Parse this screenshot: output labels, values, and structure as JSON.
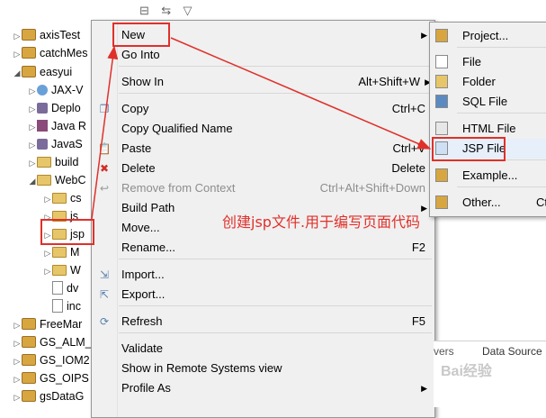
{
  "explorer": {
    "items": [
      {
        "label": "axisTest",
        "indent": 0,
        "twisty": "▷",
        "icon": "project-icon"
      },
      {
        "label": "catchMes",
        "indent": 0,
        "twisty": "▷",
        "icon": "project-icon"
      },
      {
        "label": "easyui",
        "indent": 0,
        "twisty": "◢",
        "icon": "project-icon"
      },
      {
        "label": "JAX-V",
        "indent": 1,
        "twisty": "▷",
        "icon": "web-service-icon"
      },
      {
        "label": "Deplo",
        "indent": 1,
        "twisty": "▷",
        "icon": "deploy-icon"
      },
      {
        "label": "Java R",
        "indent": 1,
        "twisty": "▷",
        "icon": "java-resources-icon"
      },
      {
        "label": "JavaS",
        "indent": 1,
        "twisty": "▷",
        "icon": "library-icon"
      },
      {
        "label": "build",
        "indent": 1,
        "twisty": "▷",
        "icon": "folder-icon"
      },
      {
        "label": "WebC",
        "indent": 1,
        "twisty": "◢",
        "icon": "folder-icon"
      },
      {
        "label": "cs",
        "indent": 2,
        "twisty": "▷",
        "icon": "folder-icon"
      },
      {
        "label": "js",
        "indent": 2,
        "twisty": "▷",
        "icon": "folder-icon"
      },
      {
        "label": "jsp",
        "indent": 2,
        "twisty": "▷",
        "icon": "folder-icon"
      },
      {
        "label": "M",
        "indent": 2,
        "twisty": "▷",
        "icon": "folder-icon"
      },
      {
        "label": "W",
        "indent": 2,
        "twisty": "▷",
        "icon": "folder-icon"
      },
      {
        "label": "dv",
        "indent": 2,
        "twisty": "",
        "icon": "file-icon"
      },
      {
        "label": "inc",
        "indent": 2,
        "twisty": "",
        "icon": "file-icon"
      },
      {
        "label": "FreeMar",
        "indent": 0,
        "twisty": "▷",
        "icon": "project-icon"
      },
      {
        "label": "GS_ALM_",
        "indent": 0,
        "twisty": "▷",
        "icon": "project-icon"
      },
      {
        "label": "GS_IOM2",
        "indent": 0,
        "twisty": "▷",
        "icon": "project-icon"
      },
      {
        "label": "GS_OIPS",
        "indent": 0,
        "twisty": "▷",
        "icon": "project-icon"
      },
      {
        "label": "gsDataG",
        "indent": 0,
        "twisty": "▷",
        "icon": "project-icon"
      }
    ]
  },
  "context_menu": {
    "items": [
      {
        "label": "New",
        "shortcut": "",
        "submenu": true,
        "disabled": false,
        "icon": ""
      },
      {
        "label": "Go Into",
        "shortcut": "",
        "submenu": false,
        "disabled": false,
        "icon": ""
      },
      {
        "label": "Show In",
        "shortcut": "Alt+Shift+W",
        "submenu": true,
        "disabled": false,
        "icon": ""
      },
      {
        "label": "Copy",
        "shortcut": "Ctrl+C",
        "submenu": false,
        "disabled": false,
        "icon": "copy-icon"
      },
      {
        "label": "Copy Qualified Name",
        "shortcut": "",
        "submenu": false,
        "disabled": false,
        "icon": ""
      },
      {
        "label": "Paste",
        "shortcut": "Ctrl+V",
        "submenu": false,
        "disabled": false,
        "icon": "paste-icon"
      },
      {
        "label": "Delete",
        "shortcut": "Delete",
        "submenu": false,
        "disabled": false,
        "icon": "delete-icon"
      },
      {
        "label": "Remove from Context",
        "shortcut": "Ctrl+Alt+Shift+Down",
        "submenu": false,
        "disabled": true,
        "icon": "remove-context-icon"
      },
      {
        "label": "Build Path",
        "shortcut": "",
        "submenu": true,
        "disabled": false,
        "icon": ""
      },
      {
        "label": "Move...",
        "shortcut": "",
        "submenu": false,
        "disabled": false,
        "icon": ""
      },
      {
        "label": "Rename...",
        "shortcut": "F2",
        "submenu": false,
        "disabled": false,
        "icon": ""
      },
      {
        "label": "Import...",
        "shortcut": "",
        "submenu": false,
        "disabled": false,
        "icon": "import-icon"
      },
      {
        "label": "Export...",
        "shortcut": "",
        "submenu": false,
        "disabled": false,
        "icon": "export-icon"
      },
      {
        "label": "Refresh",
        "shortcut": "F5",
        "submenu": false,
        "disabled": false,
        "icon": "refresh-icon"
      },
      {
        "label": "Validate",
        "shortcut": "",
        "submenu": false,
        "disabled": false,
        "icon": ""
      },
      {
        "label": "Show in Remote Systems view",
        "shortcut": "",
        "submenu": false,
        "disabled": false,
        "icon": ""
      },
      {
        "label": "Profile As",
        "shortcut": "",
        "submenu": true,
        "disabled": false,
        "icon": ""
      }
    ]
  },
  "new_submenu": {
    "items": [
      {
        "label": "Project...",
        "icon": "new-project-icon"
      },
      {
        "label": "File",
        "icon": "new-file-icon"
      },
      {
        "label": "Folder",
        "icon": "new-folder-icon"
      },
      {
        "label": "SQL File",
        "icon": "sql-file-icon"
      },
      {
        "label": "HTML File",
        "icon": "html-file-icon"
      },
      {
        "label": "JSP File",
        "icon": "jsp-file-icon"
      },
      {
        "label": "Example...",
        "icon": "example-icon"
      },
      {
        "label": "Other...",
        "icon": "other-icon",
        "shortcut": "Ctr"
      }
    ]
  },
  "annotation": {
    "text": "创建jsp文件.用于编写页面代码"
  },
  "bottom_panel": {
    "tab1": "vers",
    "tab2": "Data Source"
  },
  "watermark": {
    "text": "Bai经验"
  },
  "colors": {
    "annotation_red": "#e0302a",
    "menu_bg": "#f0f0f0",
    "highlight": "#e6effa"
  }
}
